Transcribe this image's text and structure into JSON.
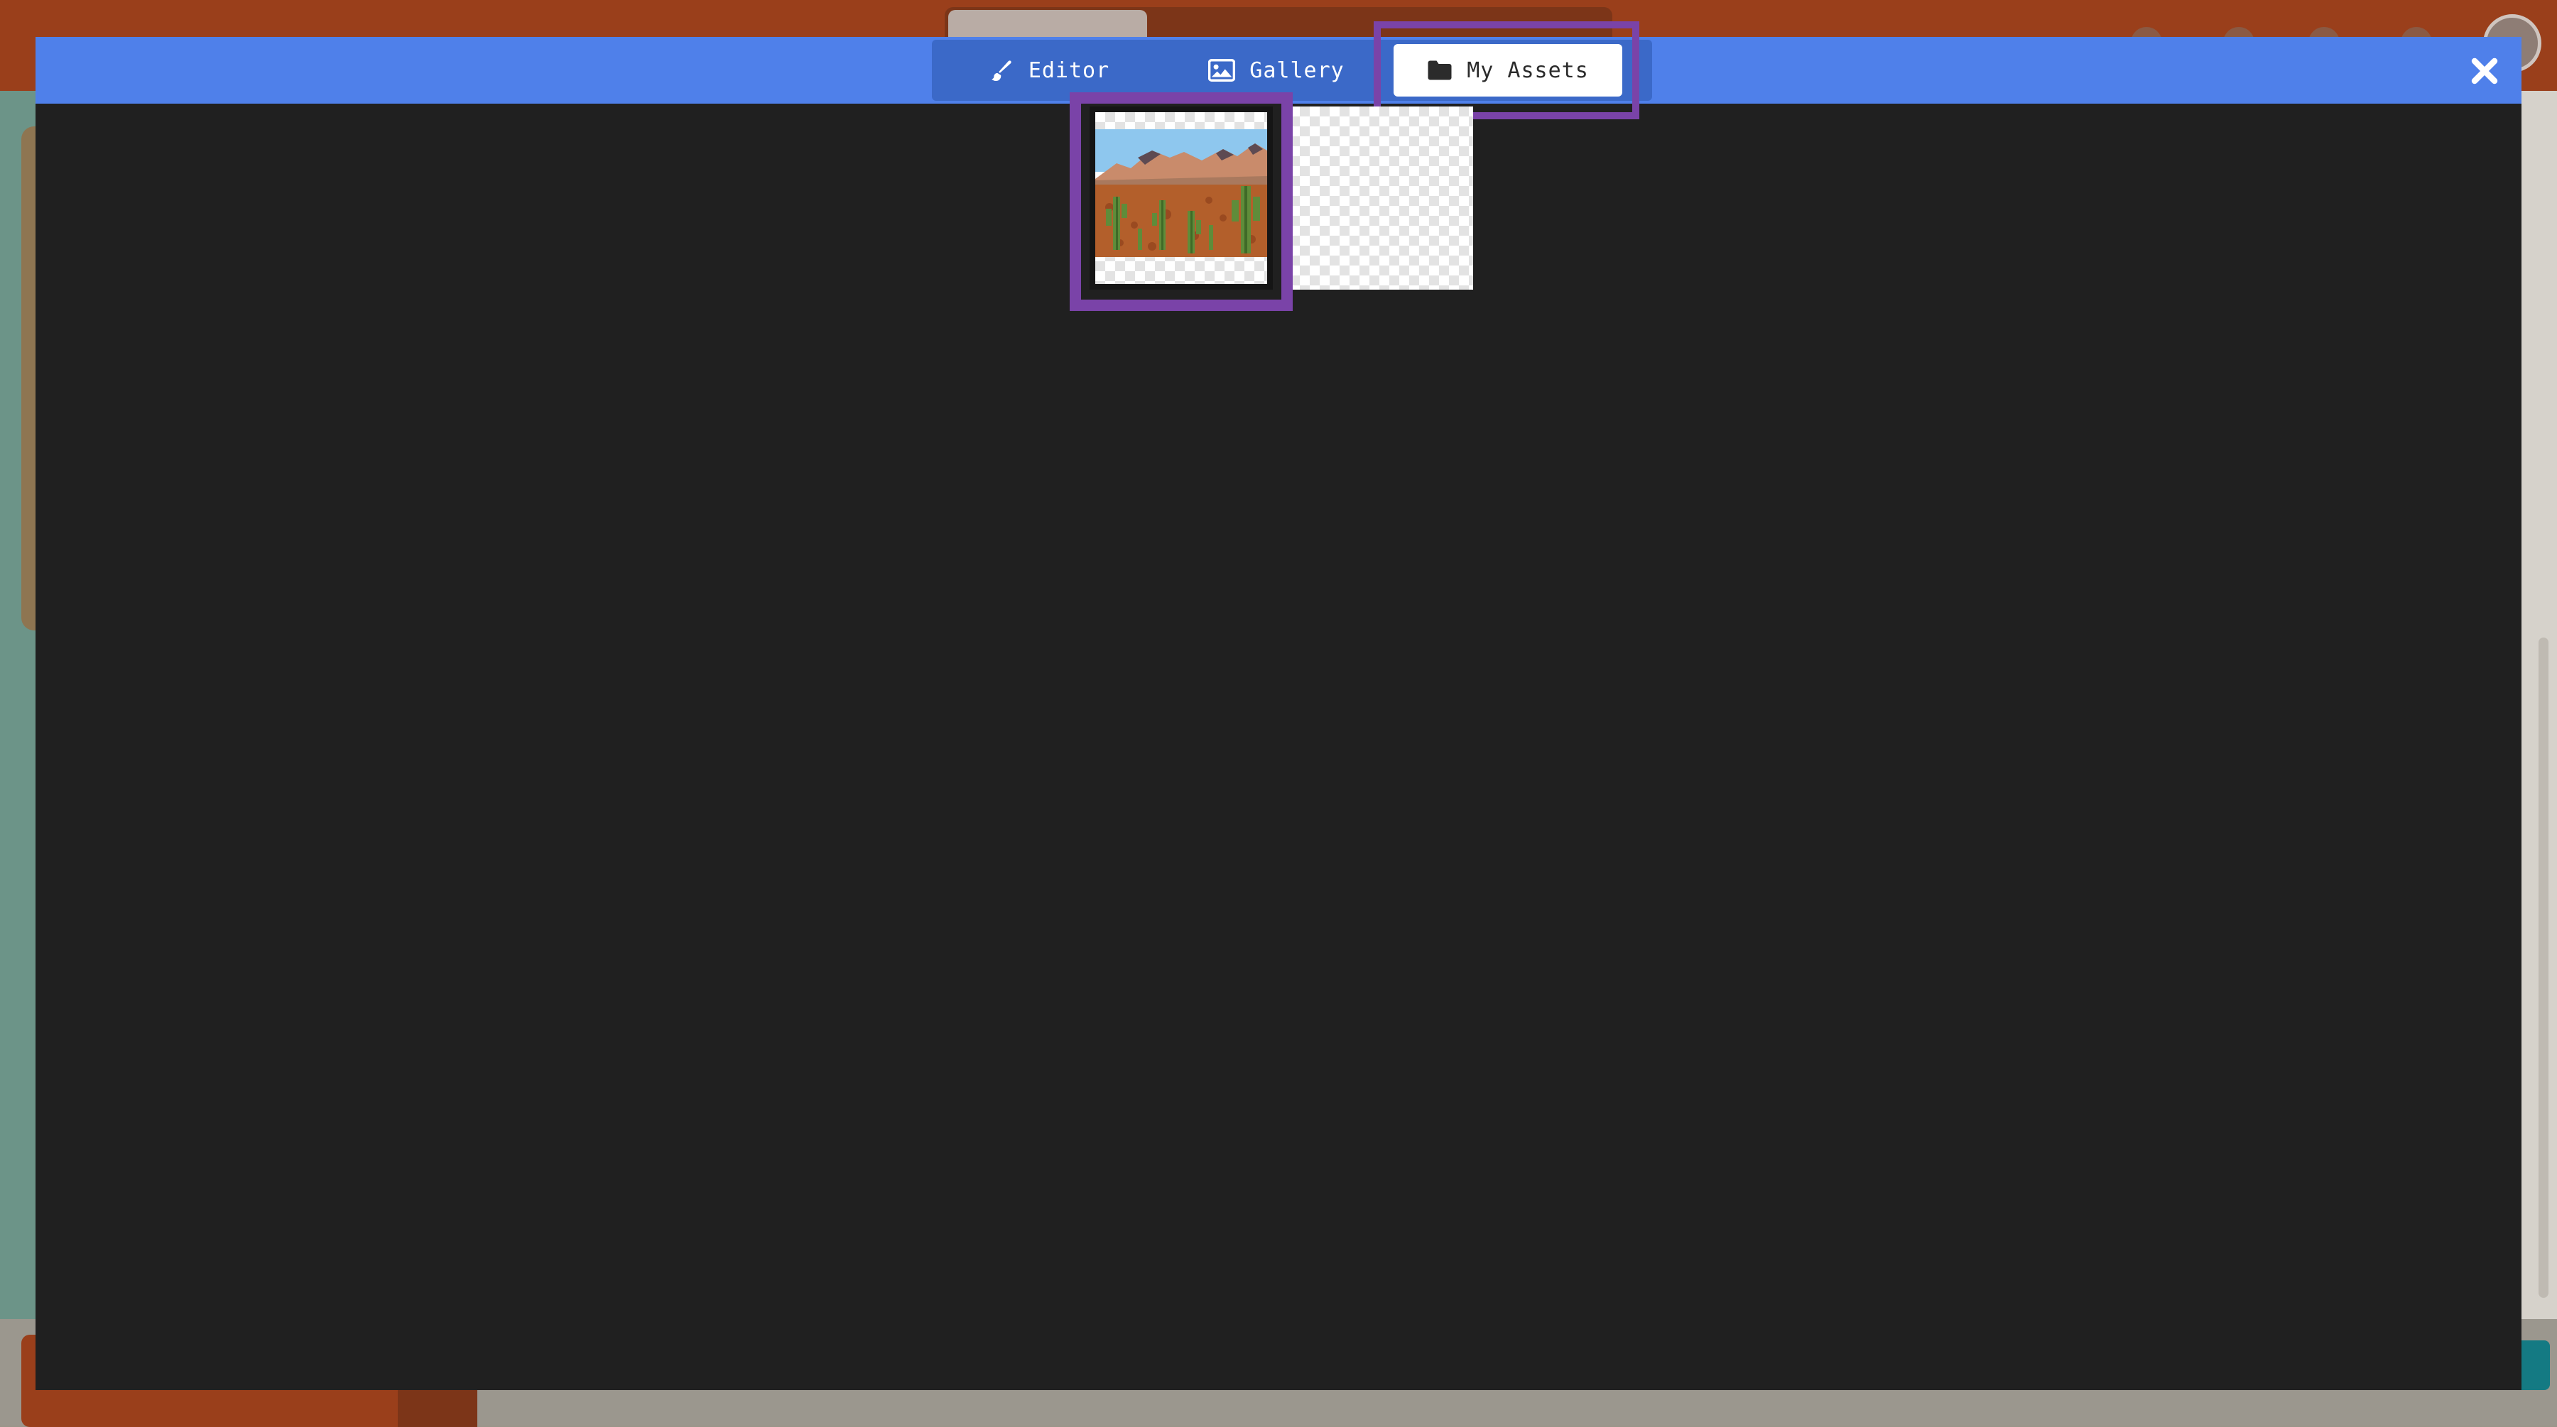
{
  "modal": {
    "tabs": [
      {
        "label": "Editor",
        "icon": "paintbrush-icon"
      },
      {
        "label": "Gallery",
        "icon": "image-icon"
      },
      {
        "label": "My Assets",
        "icon": "folder-icon"
      }
    ],
    "active_tab": "My Assets",
    "close_icon": "close-icon",
    "header_color": "#4f80ea",
    "highlight_color": "#7a43a8"
  },
  "assets": [
    {
      "kind": "image",
      "subject": "desert with saguaro cacti and mountains",
      "selected": true
    },
    {
      "kind": "image",
      "subject": "transparent / empty",
      "selected": false
    }
  ]
}
